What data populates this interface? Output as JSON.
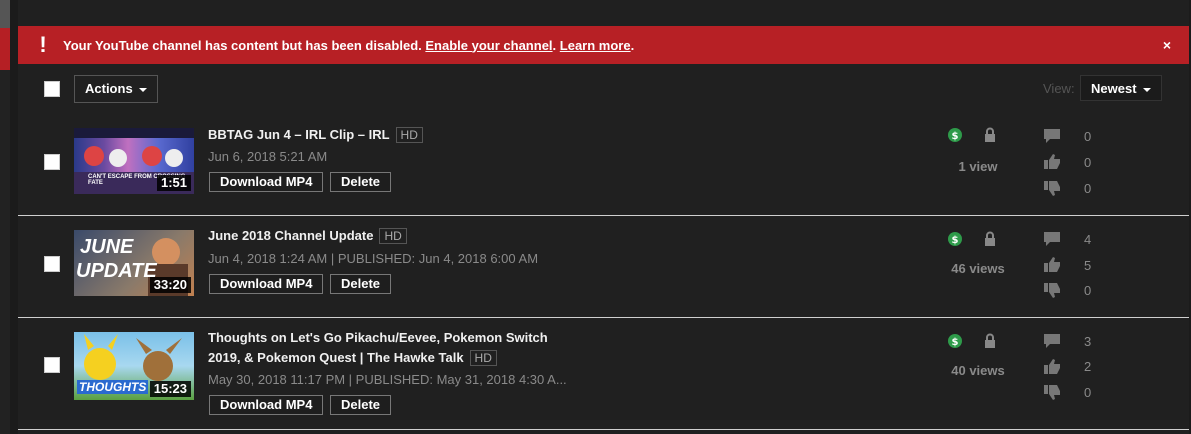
{
  "alert": {
    "message": "Your YouTube channel has content but has been disabled.",
    "enable_link": "Enable your channel",
    "learn_link": "Learn more",
    "close": "×"
  },
  "toolbar": {
    "actions_label": "Actions",
    "view_label": "View:",
    "sort_label": "Newest"
  },
  "videos": [
    {
      "title": "BBTAG Jun 4 – IRL Clip – IRL",
      "title_line2": "",
      "hd": "HD",
      "date": "Jun 6, 2018 5:21 AM",
      "duration": "1:51",
      "thumb_caption": "CAN'T ESCAPE FROM CROSSING FATE",
      "views": "1 view",
      "comments": "0",
      "likes": "0",
      "dislikes": "0",
      "download_label": "Download MP4",
      "delete_label": "Delete"
    },
    {
      "title": "June 2018 Channel Update",
      "title_line2": "",
      "hd": "HD",
      "date": "Jun 4, 2018 1:24 AM  |  PUBLISHED: Jun 4, 2018 6:00 AM",
      "duration": "33:20",
      "thumb_caption_1": "JUNE",
      "thumb_caption_2": "UPDATE",
      "views": "46 views",
      "comments": "4",
      "likes": "5",
      "dislikes": "0",
      "download_label": "Download MP4",
      "delete_label": "Delete"
    },
    {
      "title": "Thoughts on Let's Go Pikachu/Eevee, Pokemon Switch",
      "title_line2": "2019, & Pokemon Quest | The Hawke Talk",
      "hd": "HD",
      "date": "May 30, 2018 11:17 PM  |  PUBLISHED: May 31, 2018 4:30 A...",
      "duration": "15:23",
      "thumb_caption": "THOUGHTS",
      "views": "40 views",
      "comments": "3",
      "likes": "2",
      "dislikes": "0",
      "download_label": "Download MP4",
      "delete_label": "Delete"
    }
  ],
  "colors": {
    "alert_red": "#b72025",
    "monetization_green": "#2e9b4a",
    "background": "#202020"
  },
  "icons": [
    "exclamation-icon",
    "close-icon",
    "dollar-icon",
    "lock-icon",
    "comment-icon",
    "thumbs-up-icon",
    "thumbs-down-icon",
    "caret-down-icon"
  ]
}
